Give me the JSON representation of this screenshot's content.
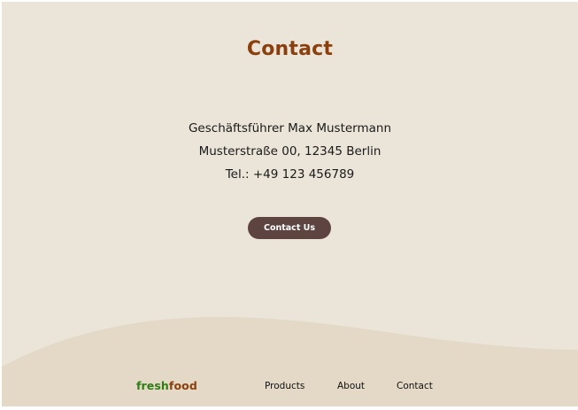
{
  "contact_section": {
    "title": "Contact",
    "address_lines": [
      "Geschäftsführer Max Mustermann",
      "Musterstraße 00, 12345 Berlin",
      "Tel.: +49 123 456789"
    ],
    "cta_label": "Contact Us"
  },
  "footer": {
    "logo_part1": "fresh",
    "logo_part2": "food",
    "nav": [
      {
        "label": "Products"
      },
      {
        "label": "About"
      },
      {
        "label": "Contact"
      }
    ]
  },
  "colors": {
    "background": "#ebe4d8",
    "wave": "#e3d9c6",
    "title": "#8b3f0d",
    "button": "#5e4441",
    "logo_fresh": "#2e7d13",
    "logo_food": "#8b3f0d"
  }
}
